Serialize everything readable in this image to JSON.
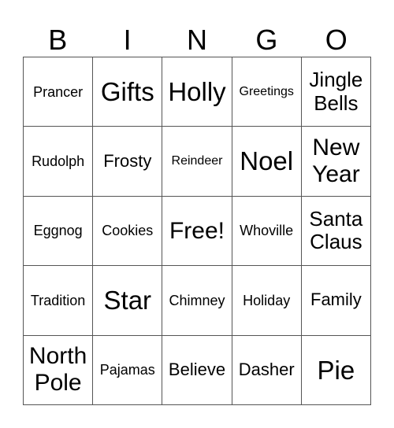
{
  "header": [
    "B",
    "I",
    "N",
    "G",
    "O"
  ],
  "board": [
    [
      {
        "text": "Prancer",
        "size": "s-sm"
      },
      {
        "text": "Gifts",
        "size": "s-xxl"
      },
      {
        "text": "Holly",
        "size": "s-xxl"
      },
      {
        "text": "Greetings",
        "size": "s-xs"
      },
      {
        "text": "Jingle Bells",
        "size": "s-lg"
      }
    ],
    [
      {
        "text": "Rudolph",
        "size": "s-sm"
      },
      {
        "text": "Frosty",
        "size": "s-md"
      },
      {
        "text": "Reindeer",
        "size": "s-xs"
      },
      {
        "text": "Noel",
        "size": "s-xxl"
      },
      {
        "text": "New Year",
        "size": "s-xl"
      }
    ],
    [
      {
        "text": "Eggnog",
        "size": "s-sm"
      },
      {
        "text": "Cookies",
        "size": "s-sm"
      },
      {
        "text": "Free!",
        "size": "s-xl"
      },
      {
        "text": "Whoville",
        "size": "s-sm"
      },
      {
        "text": "Santa Claus",
        "size": "s-lg"
      }
    ],
    [
      {
        "text": "Tradition",
        "size": "s-sm"
      },
      {
        "text": "Star",
        "size": "s-xxl"
      },
      {
        "text": "Chimney",
        "size": "s-sm"
      },
      {
        "text": "Holiday",
        "size": "s-sm"
      },
      {
        "text": "Family",
        "size": "s-md"
      }
    ],
    [
      {
        "text": "North Pole",
        "size": "s-xl"
      },
      {
        "text": "Pajamas",
        "size": "s-sm"
      },
      {
        "text": "Believe",
        "size": "s-md"
      },
      {
        "text": "Dasher",
        "size": "s-md"
      },
      {
        "text": "Pie",
        "size": "s-xxl"
      }
    ]
  ]
}
